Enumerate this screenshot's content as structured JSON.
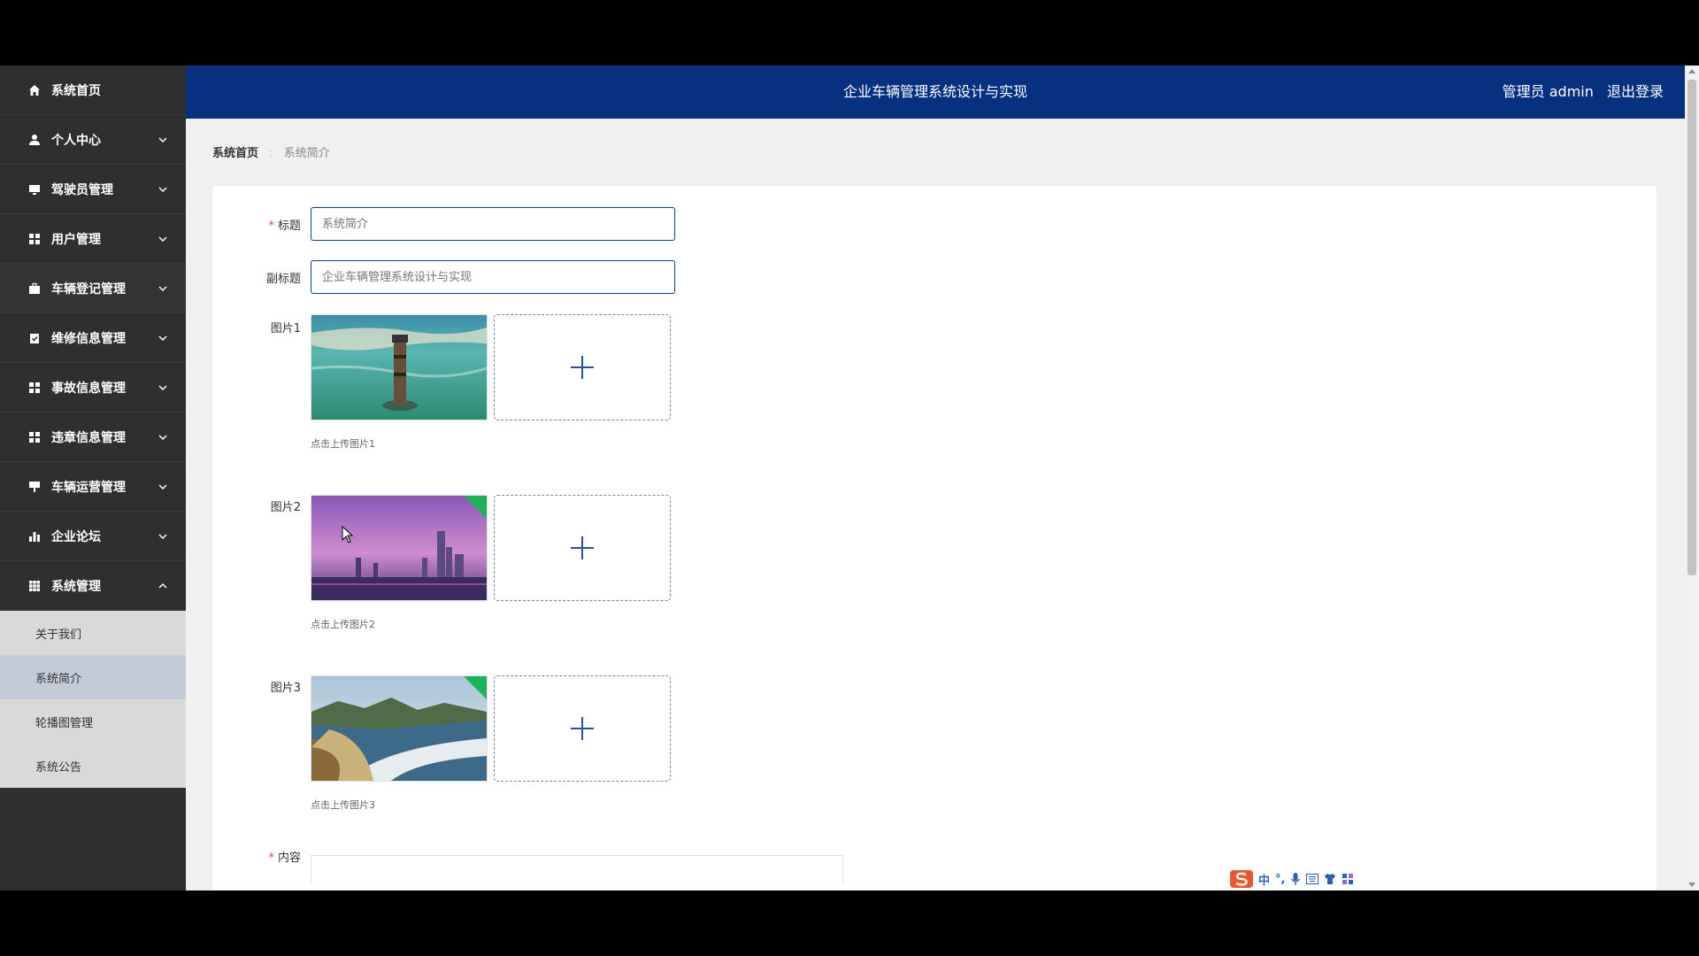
{
  "header": {
    "title": "企业车辆管理系统设计与实现",
    "role_label": "管理员 admin",
    "logout_label": "退出登录"
  },
  "sidebar": {
    "items": [
      {
        "label": "系统首页",
        "icon": "home-icon"
      },
      {
        "label": "个人中心",
        "icon": "user-icon"
      },
      {
        "label": "驾驶员管理",
        "icon": "monitor-icon"
      },
      {
        "label": "用户管理",
        "icon": "grid-icon"
      },
      {
        "label": "车辆登记管理",
        "icon": "briefcase-icon"
      },
      {
        "label": "维修信息管理",
        "icon": "clipboard-icon"
      },
      {
        "label": "事故信息管理",
        "icon": "grid-icon"
      },
      {
        "label": "违章信息管理",
        "icon": "grid-icon"
      },
      {
        "label": "车辆运营管理",
        "icon": "sign-icon"
      },
      {
        "label": "企业论坛",
        "icon": "bar-chart-icon"
      },
      {
        "label": "系统管理",
        "icon": "table-icon"
      }
    ],
    "submenu": [
      {
        "label": "关于我们"
      },
      {
        "label": "系统简介"
      },
      {
        "label": "轮播图管理"
      },
      {
        "label": "系统公告"
      }
    ]
  },
  "breadcrumb": {
    "home": "系统首页",
    "current": "系统简介"
  },
  "form": {
    "title_label": "标题",
    "title_value": "系统简介",
    "subtitle_label": "副标题",
    "subtitle_value": "企业车辆管理系统设计与实现",
    "images": [
      {
        "label": "图片1",
        "hint": "点击上传图片1"
      },
      {
        "label": "图片2",
        "hint": "点击上传图片2"
      },
      {
        "label": "图片3",
        "hint": "点击上传图片3"
      }
    ],
    "content_label": "内容"
  },
  "ime": {
    "mode_label": "中",
    "punct_label": "°,"
  },
  "colors": {
    "header_bg": "#07317f",
    "sidebar_bg": "#2f2f2f",
    "submenu_bg": "#d9d9d9",
    "submenu_active": "#c3cbd9",
    "required": "#e14b4b"
  }
}
